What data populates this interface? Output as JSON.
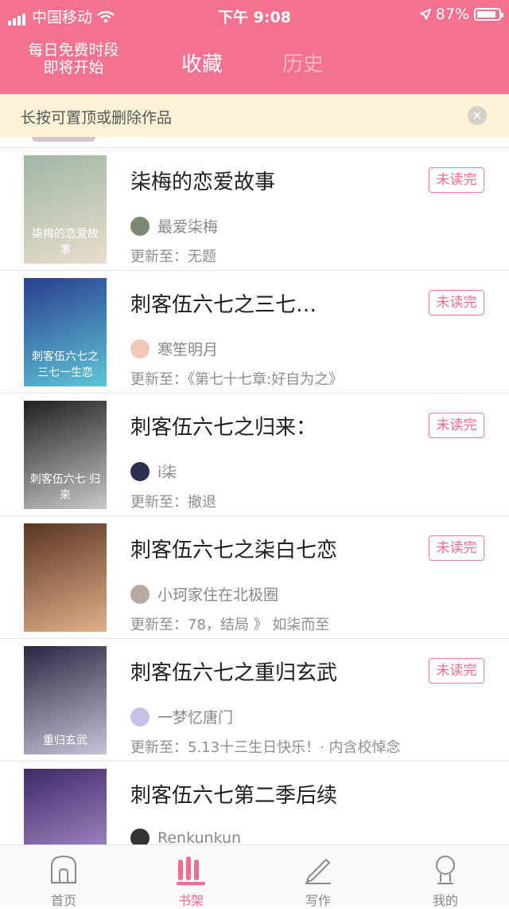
{
  "status_bar": {
    "carrier": "中国移动",
    "time": "下午 9:08",
    "battery": "87%",
    "battery_level": 0.87
  },
  "header": {
    "promo_line1": "每日免费时段",
    "promo_line2": "即将开始",
    "tabs": [
      {
        "label": "收藏"
      },
      {
        "label": "历史"
      }
    ]
  },
  "notice": {
    "text": "长按可置顶或删除作品",
    "close_icon": "×"
  },
  "books": [
    {
      "title": "柒梅的恋爱故事",
      "badge": "未读完",
      "author": "最爱柒梅",
      "update": "更新至：无题",
      "cover_text": "柒梅的恋爱故事",
      "cover_colors": [
        "#9fb7a4",
        "#e9ddcc"
      ],
      "avatar_color": "#7c8a73"
    },
    {
      "title": "刺客伍六七之三七…",
      "badge": "未读完",
      "author": "寒笙明月",
      "update": "更新至：《第七十七章:好自为之》",
      "cover_text": "刺客伍六七之三七一生恋",
      "cover_colors": [
        "#2a3e8f",
        "#5ec6d6"
      ],
      "avatar_color": "#f0c7b8"
    },
    {
      "title": "刺客伍六七之归来：",
      "badge": "未读完",
      "author": "i柒",
      "update": "更新至：撤退",
      "cover_text": "刺客伍六七 归来",
      "cover_colors": [
        "#202020",
        "#c9c9c9"
      ],
      "avatar_color": "#2c2f4a"
    },
    {
      "title": "刺客伍六七之柒白七恋",
      "badge": "未读完",
      "author": "小珂家住在北极圈",
      "update": "更新至：78，结局 》 如柒而至",
      "cover_text": "",
      "cover_colors": [
        "#5a3522",
        "#e1b08a"
      ],
      "avatar_color": "#b9a9a3"
    },
    {
      "title": "刺客伍六七之重归玄武",
      "badge": "未读完",
      "author": "一梦忆唐门",
      "update": "更新至：5.13十三生日快乐！· 内含校悼念",
      "cover_text": "重归玄武",
      "cover_colors": [
        "#2b2540",
        "#c9c3d8"
      ],
      "avatar_color": "#c7c2e6"
    },
    {
      "title": "刺客伍六七第二季后续",
      "badge": "",
      "author": "Renkunkun",
      "update": "",
      "cover_text": "",
      "cover_colors": [
        "#3f2a66",
        "#b59ad8"
      ],
      "avatar_color": "#333333"
    }
  ],
  "nav": [
    {
      "label": "首页",
      "icon": "home-icon"
    },
    {
      "label": "书架",
      "icon": "bookshelf-icon"
    },
    {
      "label": "写作",
      "icon": "pen-icon"
    },
    {
      "label": "我的",
      "icon": "profile-icon"
    }
  ],
  "colors": {
    "brand": "#f2728f",
    "badge": "#ef6c8d",
    "notice_bg": "#fcf3d6"
  }
}
